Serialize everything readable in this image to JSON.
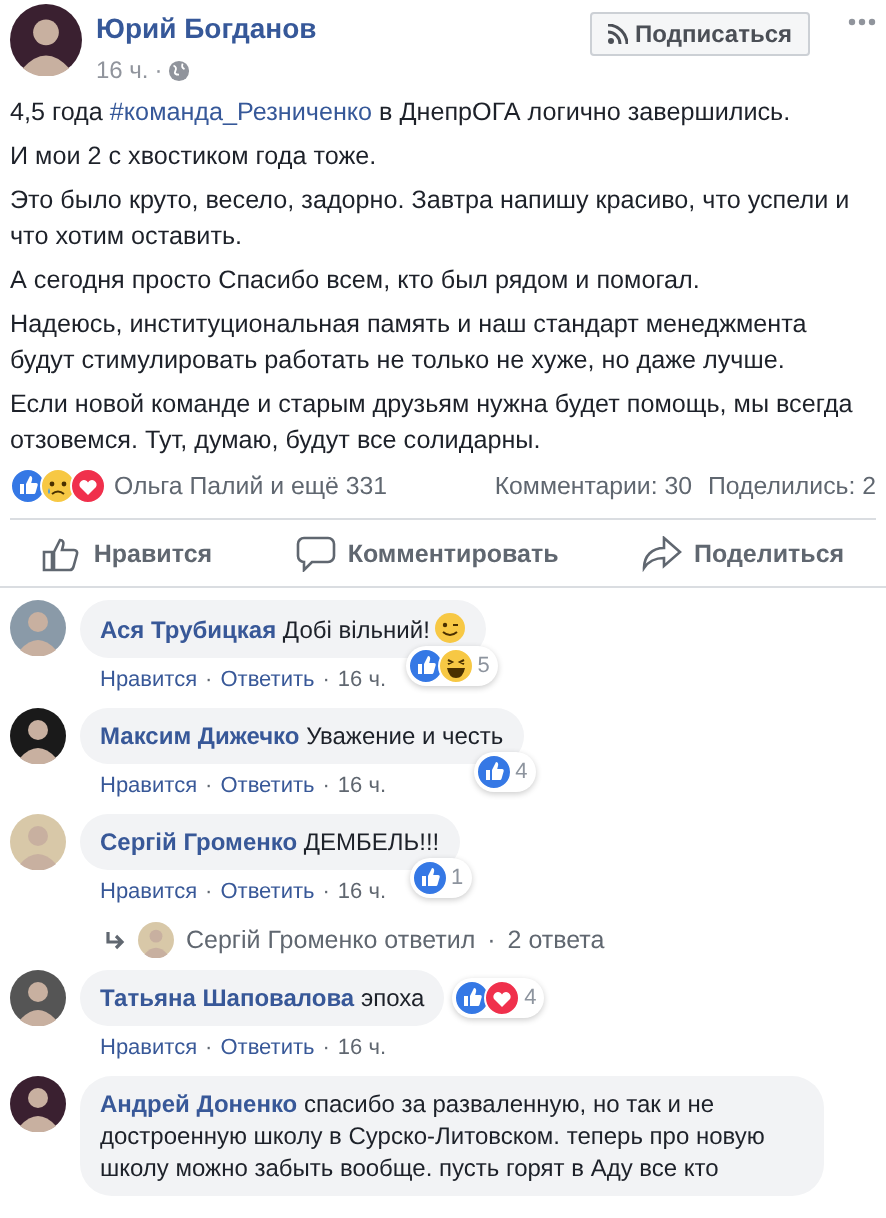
{
  "author": {
    "name": "Юрий Богданов",
    "time": "16 ч."
  },
  "subscribe_button": "Подписаться",
  "separator": "·",
  "post": {
    "paragraphs": [
      [
        {
          "text": "4,5 года "
        },
        {
          "text": "#команда_Резниченко",
          "kind": "link"
        },
        {
          "text": " в ДнепрОГА логично завершились."
        }
      ],
      [
        {
          "text": "И мои 2 с хвостиком года тоже."
        }
      ],
      [
        {
          "text": "Это было круто, весело, задорно. Завтра напишу красиво, что успели и что хотим оставить."
        }
      ],
      [
        {
          "text": "А сегодня просто Спасибо всем, кто был рядом и помогал."
        }
      ],
      [
        {
          "text": "Надеюсь, институциональная память и наш стандарт менеджмента будут стимулировать работать не только не хуже, но даже лучше."
        }
      ],
      [
        {
          "text": "Если новой команде и старым друзьям нужна будет помощь, мы всегда отзовемся. Тут, думаю, будут все солидарны."
        }
      ]
    ]
  },
  "reactions": {
    "icons": [
      {
        "kind": "like"
      },
      {
        "kind": "sad"
      },
      {
        "kind": "love"
      }
    ],
    "names": "Ольга Палий и ещё 331",
    "comments": "Комментарии: 30",
    "shares": "Поделились: 2"
  },
  "actions": [
    {
      "kind": "like",
      "label": "Нравится"
    },
    {
      "kind": "comment",
      "label": "Комментировать"
    },
    {
      "kind": "share",
      "label": "Поделиться"
    }
  ],
  "comments": [
    {
      "author": "Ася Трубицкая",
      "text": "Добі вільний!",
      "emoji": {
        "kind": "wink"
      },
      "reactions": [
        {
          "kind": "like"
        },
        {
          "kind": "haha"
        }
      ],
      "reaction_count": "5",
      "like": "Нравится",
      "reply": "Ответить",
      "time": "16 ч."
    },
    {
      "author": "Максим Дижечко",
      "text": "Уважение и честь",
      "reactions": [
        {
          "kind": "like"
        }
      ],
      "reaction_count": "4",
      "like": "Нравится",
      "reply": "Ответить",
      "time": "16 ч."
    },
    {
      "author": "Сергій Громенко",
      "text": "ДЕМБЕЛЬ!!!",
      "reactions": [
        {
          "kind": "like"
        }
      ],
      "reaction_count": "1",
      "like": "Нравится",
      "reply": "Ответить",
      "time": "16 ч.",
      "replies": {
        "author": "Сергій Громенко ответил",
        "count": "2 ответа"
      }
    },
    {
      "author": "Татьяна Шаповалова",
      "text": "эпоха",
      "reactions": [
        {
          "kind": "like"
        },
        {
          "kind": "love"
        }
      ],
      "reaction_count": "4",
      "like": "Нравится",
      "reply": "Ответить",
      "time": "16 ч."
    },
    {
      "author": "Андрей Доненко",
      "text": "спасибо за разваленную, но так и не достроенную школу в Сурско-Литовском. теперь про новую школу можно забыть вообще. пусть горят в Аду все кто"
    }
  ]
}
